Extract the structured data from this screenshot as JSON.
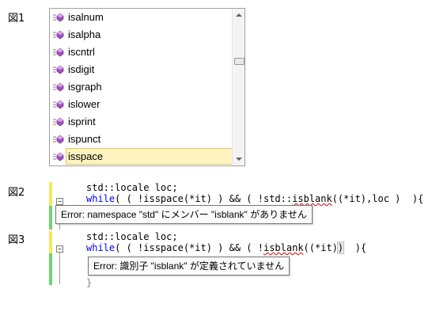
{
  "figures": {
    "fig1_label": "図1",
    "fig2_label": "図2",
    "fig3_label": "図3"
  },
  "completion": {
    "items": [
      {
        "label": "isalnum",
        "icon": "method-icon"
      },
      {
        "label": "isalpha",
        "icon": "method-icon"
      },
      {
        "label": "iscntrl",
        "icon": "method-icon"
      },
      {
        "label": "isdigit",
        "icon": "method-icon"
      },
      {
        "label": "isgraph",
        "icon": "method-icon"
      },
      {
        "label": "islower",
        "icon": "method-icon"
      },
      {
        "label": "isprint",
        "icon": "method-icon"
      },
      {
        "label": "ispunct",
        "icon": "method-icon"
      },
      {
        "label": "isspace",
        "icon": "method-icon"
      }
    ],
    "selected": "isspace"
  },
  "fig2": {
    "line1": "std::locale loc;",
    "kw_while": "while",
    "l2_a": "( ( !isspace(*it) ) && ( !std::",
    "l2_err": "isblank",
    "l2_b": "((*it),loc )  ){",
    "tooltip": "Error: namespace \"std\" にメンバー \"isblank\" がありません",
    "colors": {
      "margin_yellow": "#f7e65a",
      "margin_green": "#6fd46f"
    }
  },
  "fig3": {
    "line1": "std::locale loc;",
    "kw_while": "while",
    "l2_a": "( ( !isspace(*it) ) && ( !",
    "l2_err": "isblank",
    "l2_b": "((*it)",
    "l2_paren": ")",
    "l2_c": "  ){",
    "tooltip": "Error: 識別子 \"isblank\" が定義されていません"
  }
}
